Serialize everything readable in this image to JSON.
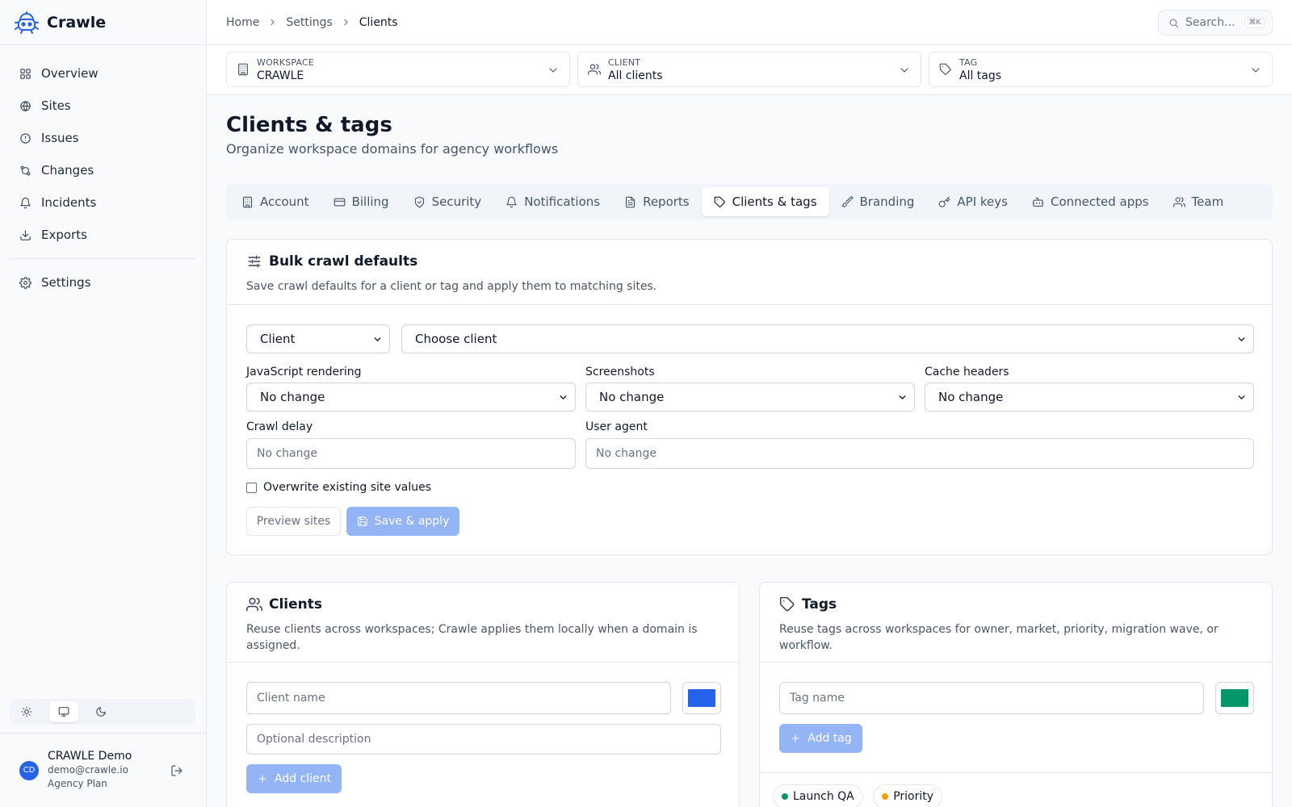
{
  "app": {
    "name": "Crawle"
  },
  "sidebar": {
    "items": [
      {
        "label": "Overview",
        "icon": "layout-grid-icon"
      },
      {
        "label": "Sites",
        "icon": "globe-icon"
      },
      {
        "label": "Issues",
        "icon": "alert-circle-icon"
      },
      {
        "label": "Changes",
        "icon": "git-compare-icon"
      },
      {
        "label": "Incidents",
        "icon": "bell-icon"
      },
      {
        "label": "Exports",
        "icon": "download-icon"
      }
    ],
    "settings_label": "Settings",
    "theme_options": [
      "light",
      "system",
      "dark"
    ],
    "theme_selected": "system",
    "user": {
      "initials": "CD",
      "name": "CRAWLE Demo",
      "email": "demo@crawle.io",
      "plan": "Agency Plan"
    }
  },
  "topbar": {
    "breadcrumb": [
      "Home",
      "Settings",
      "Clients"
    ],
    "search_placeholder": "Search...",
    "search_shortcut": "⌘K"
  },
  "filters": {
    "workspace": {
      "label": "WORKSPACE",
      "value": "CRAWLE"
    },
    "client": {
      "label": "CLIENT",
      "value": "All clients"
    },
    "tag": {
      "label": "TAG",
      "value": "All tags"
    }
  },
  "page": {
    "title": "Clients & tags",
    "subtitle": "Organize workspace domains for agency workflows"
  },
  "tabs": [
    {
      "label": "Account",
      "icon": "building-icon"
    },
    {
      "label": "Billing",
      "icon": "credit-card-icon"
    },
    {
      "label": "Security",
      "icon": "shield-icon"
    },
    {
      "label": "Notifications",
      "icon": "bell-icon"
    },
    {
      "label": "Reports",
      "icon": "file-text-icon"
    },
    {
      "label": "Clients & tags",
      "icon": "tag-icon"
    },
    {
      "label": "Branding",
      "icon": "brush-icon"
    },
    {
      "label": "API keys",
      "icon": "key-icon"
    },
    {
      "label": "Connected apps",
      "icon": "bot-icon"
    },
    {
      "label": "Team",
      "icon": "users-icon"
    }
  ],
  "active_tab": "Clients & tags",
  "bulk": {
    "title": "Bulk crawl defaults",
    "description": "Save crawl defaults for a client or tag and apply them to matching sites.",
    "scope_type": "Client",
    "scope_target": "Choose client",
    "js_rendering": {
      "label": "JavaScript rendering",
      "value": "No change"
    },
    "screenshots": {
      "label": "Screenshots",
      "value": "No change"
    },
    "cache_headers": {
      "label": "Cache headers",
      "value": "No change"
    },
    "crawl_delay": {
      "label": "Crawl delay",
      "placeholder": "No change"
    },
    "user_agent": {
      "label": "User agent",
      "placeholder": "No change"
    },
    "overwrite_label": "Overwrite existing site values",
    "overwrite_checked": false,
    "preview_label": "Preview sites",
    "save_label": "Save & apply"
  },
  "clients": {
    "title": "Clients",
    "description": "Reuse clients across workspaces; Crawle applies them locally when a domain is assigned.",
    "name_placeholder": "Client name",
    "description_placeholder": "Optional description",
    "color": "#2563eb",
    "add_label": "Add client"
  },
  "tags": {
    "title": "Tags",
    "description": "Reuse tags across workspaces for owner, market, priority, migration wave, or workflow.",
    "name_placeholder": "Tag name",
    "color": "#059669",
    "add_label": "Add tag",
    "list": [
      {
        "label": "Launch QA",
        "color": "#059669"
      },
      {
        "label": "Priority",
        "color": "#f59e0b"
      }
    ]
  },
  "colors": {
    "accent": "#2563eb",
    "accent_disabled": "#93b4f5"
  }
}
